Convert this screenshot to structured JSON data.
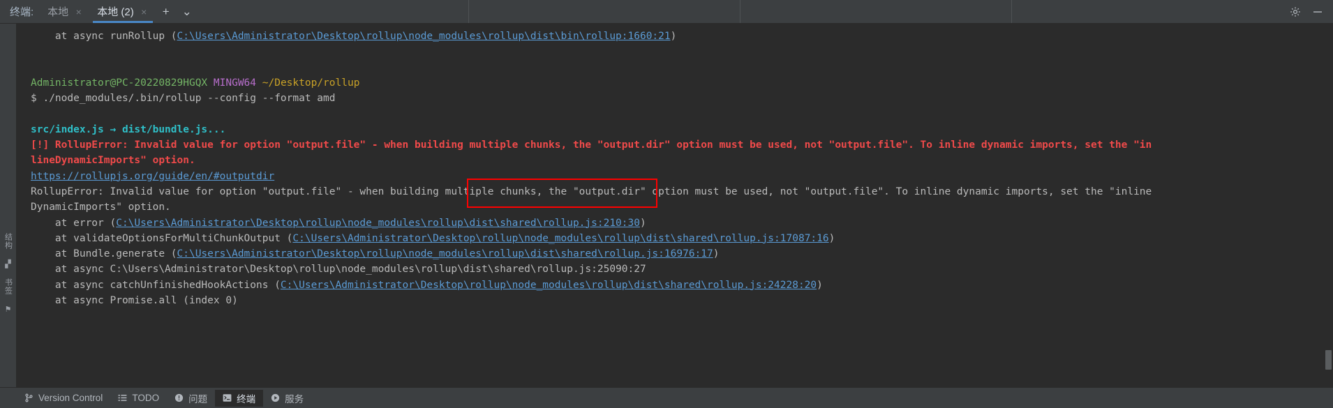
{
  "window": {
    "tabbar_label": "终端:",
    "tabs": [
      {
        "label": "本地",
        "close": "×",
        "active": false
      },
      {
        "label": "本地 (2)",
        "close": "×",
        "active": true
      }
    ],
    "add_tab": "+",
    "dropdown": "⌄",
    "settings_icon": "gear-icon",
    "minimize_icon": "minimize-icon"
  },
  "left_strip": {
    "items": [
      {
        "label": "结构",
        "name": "structure"
      },
      {
        "label": "书签",
        "name": "bookmarks"
      }
    ]
  },
  "terminal": {
    "lines": [
      {
        "id": "l1",
        "segs": [
          {
            "t": "    at async runRollup (",
            "c": "plain"
          },
          {
            "t": "C:\\Users\\Administrator\\Desktop\\rollup\\node_modules\\rollup\\dist\\bin\\rollup:1660:21",
            "c": "lnk"
          },
          {
            "t": ")",
            "c": "plain"
          }
        ]
      },
      {
        "id": "l2",
        "segs": []
      },
      {
        "id": "l3",
        "segs": []
      },
      {
        "id": "l4",
        "segs": [
          {
            "t": "Administrator@PC-20220829HGQX",
            "c": "green"
          },
          {
            "t": " ",
            "c": "plain"
          },
          {
            "t": "MINGW64",
            "c": "purple"
          },
          {
            "t": " ",
            "c": "plain"
          },
          {
            "t": "~/Desktop/rollup",
            "c": "yellow"
          }
        ]
      },
      {
        "id": "l5",
        "segs": [
          {
            "t": "$ ./node_modules/.bin/rollup --config --format amd",
            "c": "plain"
          }
        ]
      },
      {
        "id": "l6",
        "segs": []
      },
      {
        "id": "l7",
        "segs": [
          {
            "t": "src/index.js → dist/bundle.js...",
            "c": "cyan"
          }
        ]
      },
      {
        "id": "l8",
        "segs": [
          {
            "t": "[!] RollupError: Invalid value for option \"output.file\" - when building multiple chunks, the \"output.dir\" option must be used, not \"output.file\". To inline dynamic imports, set the \"in",
            "c": "err"
          }
        ]
      },
      {
        "id": "l9",
        "segs": [
          {
            "t": "lineDynamicImports\" option.",
            "c": "err"
          }
        ]
      },
      {
        "id": "l10",
        "segs": [
          {
            "t": "https://rollupjs.org/guide/en/#outputdir",
            "c": "lnk"
          }
        ]
      },
      {
        "id": "l11",
        "segs": [
          {
            "t": "RollupError: Invalid value for option \"output.file\" - when building multiple chunks, the \"output.dir\" option must be used, not \"output.file\". To inline dynamic imports, set the \"inline",
            "c": "plain"
          }
        ]
      },
      {
        "id": "l12",
        "segs": [
          {
            "t": "DynamicImports\" option.",
            "c": "plain"
          }
        ]
      },
      {
        "id": "l13",
        "segs": [
          {
            "t": "    at error (",
            "c": "plain"
          },
          {
            "t": "C:\\Users\\Administrator\\Desktop\\rollup\\node_modules\\rollup\\dist\\shared\\rollup.js:210:30",
            "c": "lnk"
          },
          {
            "t": ")",
            "c": "plain"
          }
        ]
      },
      {
        "id": "l14",
        "segs": [
          {
            "t": "    at validateOptionsForMultiChunkOutput (",
            "c": "plain"
          },
          {
            "t": "C:\\Users\\Administrator\\Desktop\\rollup\\node_modules\\rollup\\dist\\shared\\rollup.js:17087:16",
            "c": "lnk"
          },
          {
            "t": ")",
            "c": "plain"
          }
        ]
      },
      {
        "id": "l15",
        "segs": [
          {
            "t": "    at Bundle.generate (",
            "c": "plain"
          },
          {
            "t": "C:\\Users\\Administrator\\Desktop\\rollup\\node_modules\\rollup\\dist\\shared\\rollup.js:16976:17",
            "c": "lnk"
          },
          {
            "t": ")",
            "c": "plain"
          }
        ]
      },
      {
        "id": "l16",
        "segs": [
          {
            "t": "    at async C:\\Users\\Administrator\\Desktop\\rollup\\node_modules\\rollup\\dist\\shared\\rollup.js:25090:27",
            "c": "plain"
          }
        ]
      },
      {
        "id": "l17",
        "segs": [
          {
            "t": "    at async catchUnfinishedHookActions (",
            "c": "plain"
          },
          {
            "t": "C:\\Users\\Administrator\\Desktop\\rollup\\node_modules\\rollup\\dist\\shared\\rollup.js:24228:20",
            "c": "lnk"
          },
          {
            "t": ")",
            "c": "plain"
          }
        ]
      },
      {
        "id": "l18",
        "segs": [
          {
            "t": "    at async Promise.all (index 0)",
            "c": "plain"
          }
        ]
      }
    ],
    "annotation": {
      "type": "red-rectangle",
      "highlighted_text": "building multiple chunks,",
      "color": "#ff0000"
    }
  },
  "statusbar": {
    "items": [
      {
        "label": "Version Control",
        "icon": "branch-icon",
        "active": false
      },
      {
        "label": "TODO",
        "icon": "list-icon",
        "active": false
      },
      {
        "label": "问题",
        "icon": "warning-icon",
        "active": false
      },
      {
        "label": "终端",
        "icon": "terminal-icon",
        "active": true
      },
      {
        "label": "服务",
        "icon": "play-icon",
        "active": false
      }
    ]
  },
  "colors": {
    "accent": "#4a88c7",
    "error": "#f04a4a",
    "link": "#5b9bd5",
    "annotation": "#ff0000",
    "terminal_bg": "#2b2b2b",
    "chrome_bg": "#3c3f41"
  }
}
